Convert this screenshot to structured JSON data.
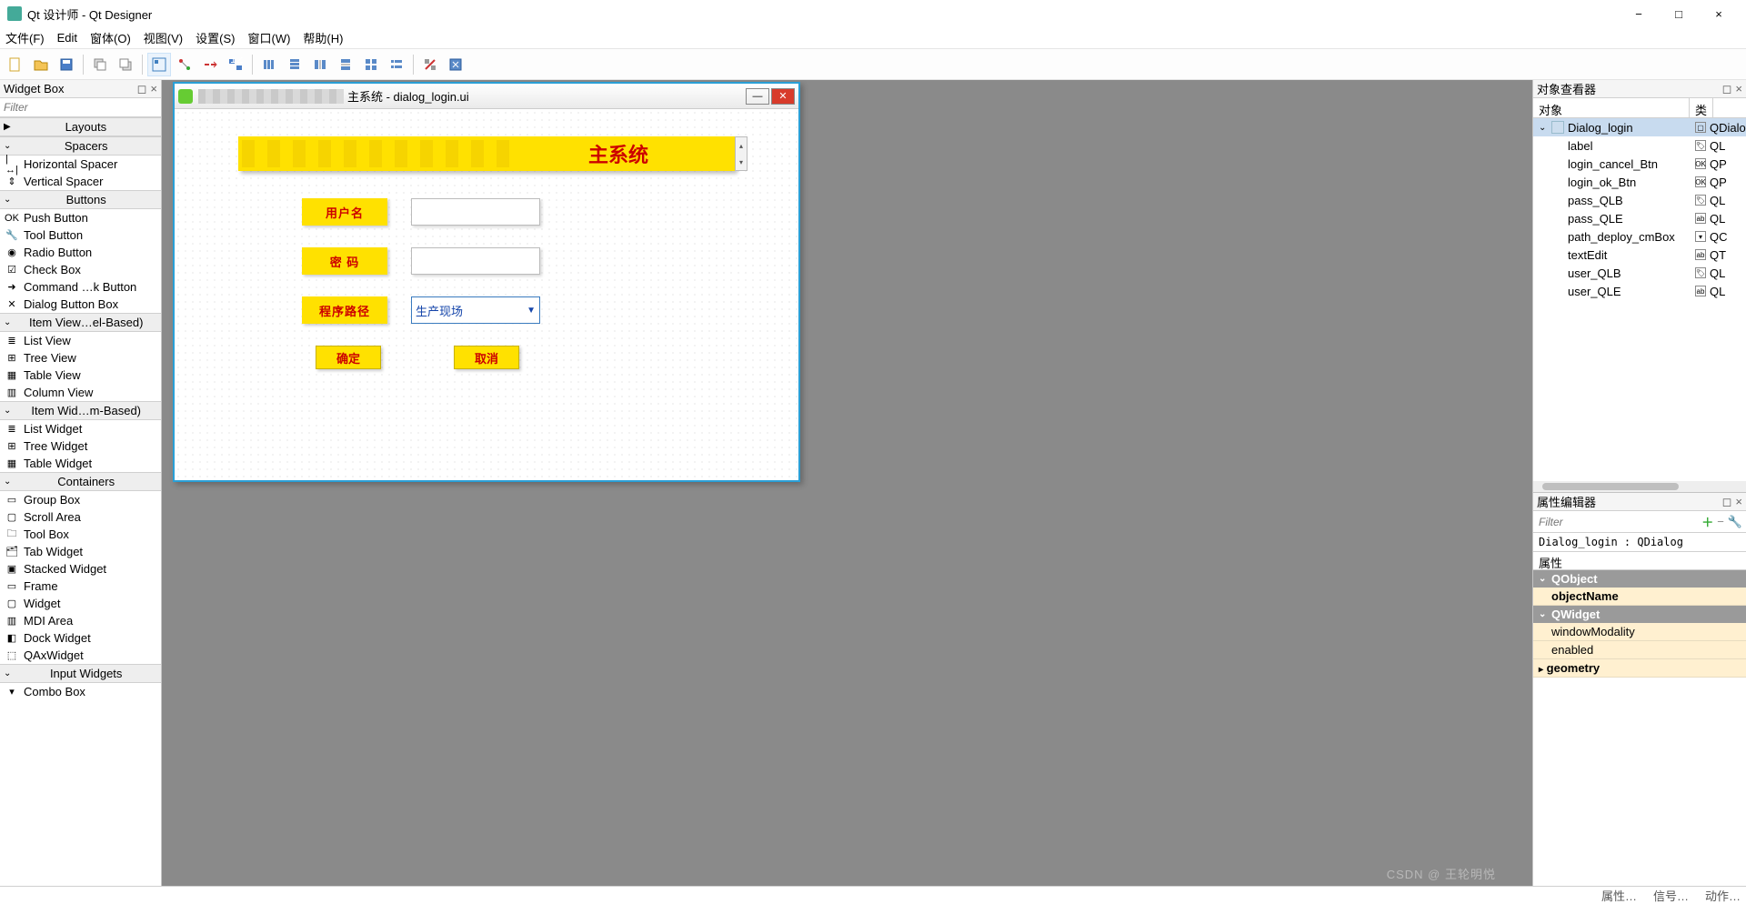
{
  "app": {
    "title": "Qt 设计师 - Qt Designer"
  },
  "window_controls": {
    "min": "−",
    "max": "□",
    "close": "×"
  },
  "menus": [
    "文件(F)",
    "Edit",
    "窗体(O)",
    "视图(V)",
    "设置(S)",
    "窗口(W)",
    "帮助(H)"
  ],
  "widgetbox": {
    "title": "Widget Box",
    "filter_placeholder": "Filter",
    "groups": [
      {
        "name": "Layouts",
        "items": []
      },
      {
        "name": "Spacers",
        "items": [
          {
            "label": "Horizontal Spacer",
            "icon": "|↔|"
          },
          {
            "label": "Vertical Spacer",
            "icon": "⇕"
          }
        ]
      },
      {
        "name": "Buttons",
        "items": [
          {
            "label": "Push Button",
            "icon": "OK"
          },
          {
            "label": "Tool Button",
            "icon": "🔧"
          },
          {
            "label": "Radio Button",
            "icon": "◉"
          },
          {
            "label": "Check Box",
            "icon": "☑"
          },
          {
            "label": "Command …k Button",
            "icon": "➜"
          },
          {
            "label": "Dialog Button Box",
            "icon": "✕"
          }
        ]
      },
      {
        "name": "Item View…el-Based)",
        "items": [
          {
            "label": "List View",
            "icon": "≣"
          },
          {
            "label": "Tree View",
            "icon": "⊞"
          },
          {
            "label": "Table View",
            "icon": "▦"
          },
          {
            "label": "Column View",
            "icon": "▥"
          }
        ]
      },
      {
        "name": "Item Wid…m-Based)",
        "items": [
          {
            "label": "List Widget",
            "icon": "≣"
          },
          {
            "label": "Tree Widget",
            "icon": "⊞"
          },
          {
            "label": "Table Widget",
            "icon": "▦"
          }
        ]
      },
      {
        "name": "Containers",
        "items": [
          {
            "label": "Group Box",
            "icon": "▭"
          },
          {
            "label": "Scroll Area",
            "icon": "▢"
          },
          {
            "label": "Tool Box",
            "icon": "🗀"
          },
          {
            "label": "Tab Widget",
            "icon": "🗂"
          },
          {
            "label": "Stacked Widget",
            "icon": "▣"
          },
          {
            "label": "Frame",
            "icon": "▭"
          },
          {
            "label": "Widget",
            "icon": "▢"
          },
          {
            "label": "MDI Area",
            "icon": "▥"
          },
          {
            "label": "Dock Widget",
            "icon": "◧"
          },
          {
            "label": "QAxWidget",
            "icon": "⬚"
          }
        ]
      },
      {
        "name": "Input Widgets",
        "items": [
          {
            "label": "Combo Box",
            "icon": "▾"
          }
        ]
      }
    ]
  },
  "dialog": {
    "title_suffix": "主系统 - dialog_login.ui",
    "banner_text": "主系统",
    "user_label": "用户名",
    "pass_label": "密   码",
    "path_label": "程序路径",
    "combo_value": "生产现场",
    "ok": "确定",
    "cancel": "取消"
  },
  "inspector": {
    "title": "对象查看器",
    "cols": [
      "对象",
      "类"
    ],
    "rows": [
      {
        "n": "Dialog_login",
        "c": "QDialo",
        "root": true,
        "sel": true
      },
      {
        "n": "label",
        "c": "QL",
        "t": "tag"
      },
      {
        "n": "login_cancel_Btn",
        "c": "QP",
        "t": "btn"
      },
      {
        "n": "login_ok_Btn",
        "c": "QP",
        "t": "btn"
      },
      {
        "n": "pass_QLB",
        "c": "QL",
        "t": "tag"
      },
      {
        "n": "pass_QLE",
        "c": "QL",
        "t": "edit"
      },
      {
        "n": "path_deploy_cmBox",
        "c": "QC",
        "t": "cmb"
      },
      {
        "n": "textEdit",
        "c": "QT",
        "t": "edit"
      },
      {
        "n": "user_QLB",
        "c": "QL",
        "t": "tag"
      },
      {
        "n": "user_QLE",
        "c": "QL",
        "t": "edit"
      }
    ]
  },
  "property": {
    "title": "属性编辑器",
    "filter_placeholder": "Filter",
    "object_desc": "Dialog_login : QDialog",
    "col": "属性",
    "sections": [
      {
        "h": "QObject",
        "rows": [
          {
            "n": "objectName",
            "bold": true
          }
        ]
      },
      {
        "h": "QWidget",
        "rows": [
          {
            "n": "windowModality"
          },
          {
            "n": "enabled"
          },
          {
            "n": "geometry",
            "bold": true,
            "exp": true
          }
        ]
      }
    ]
  },
  "status": {
    "left": "属性…",
    "mid": "信号…",
    "right": "动作…"
  },
  "watermark": "CSDN @ 王轮明悦"
}
